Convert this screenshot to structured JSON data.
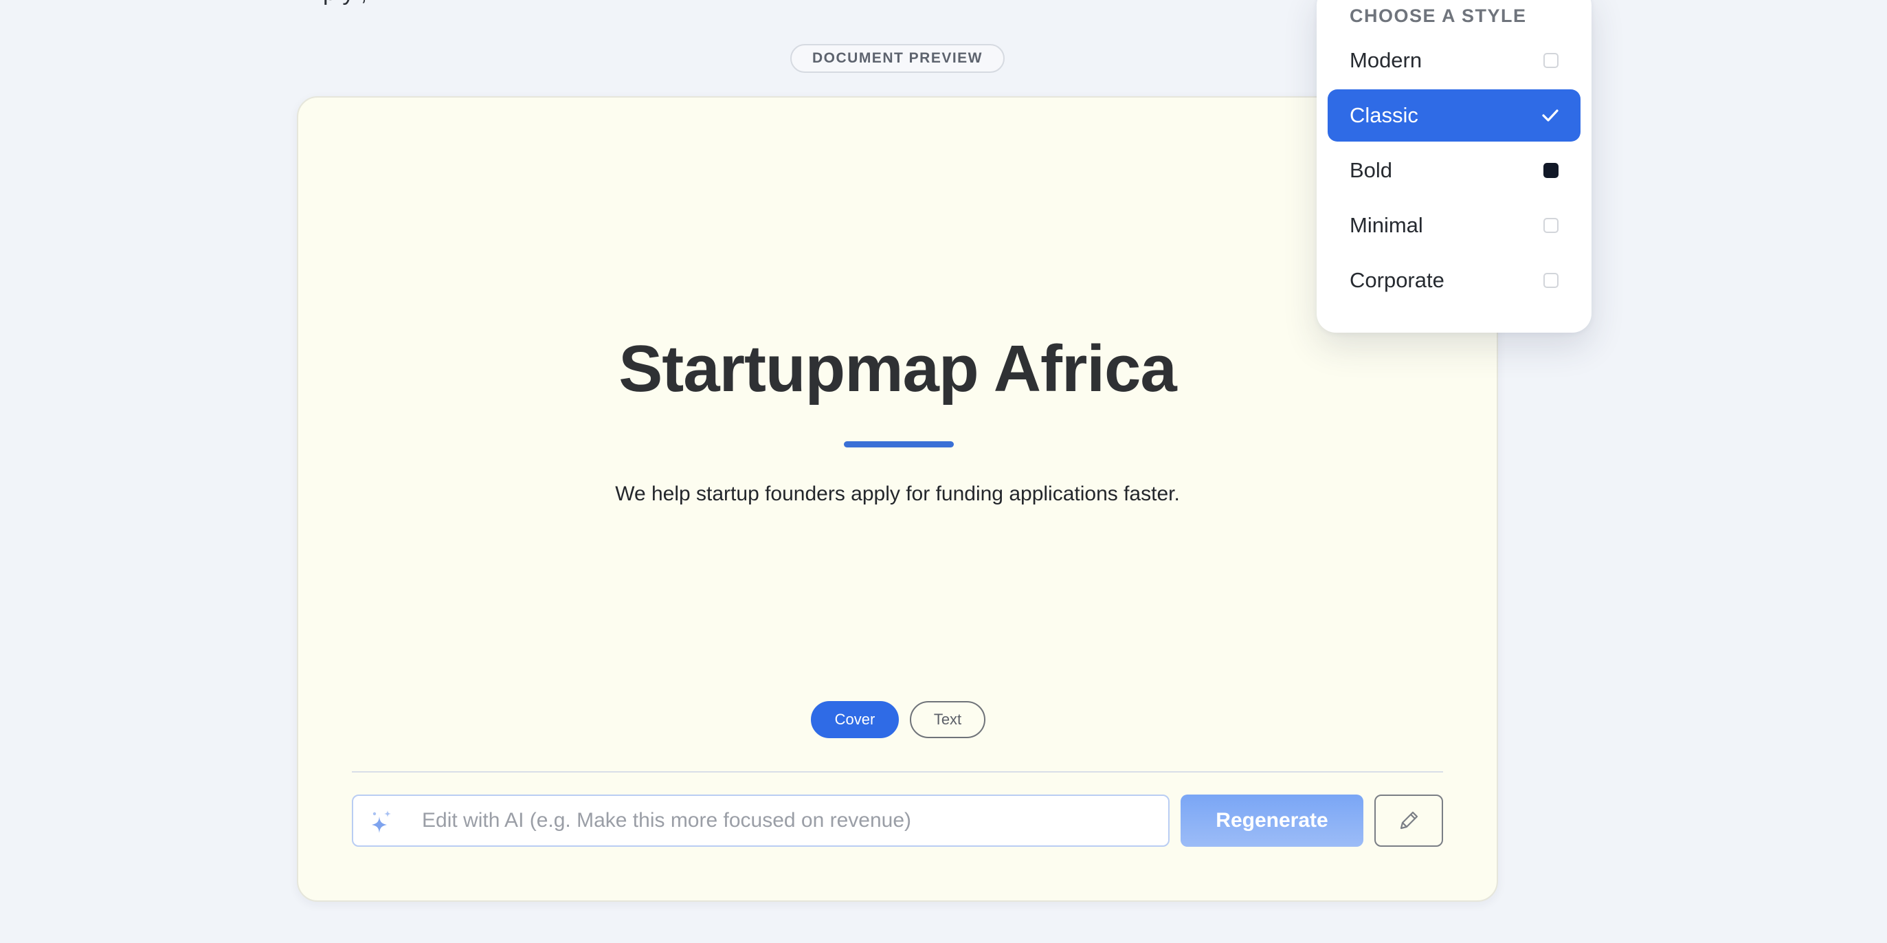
{
  "header": {
    "partial_text": "p     y                      ,"
  },
  "preview": {
    "badge_label": "DOCUMENT PREVIEW"
  },
  "document": {
    "title": "Startupmap Africa",
    "subtitle": "We help startup founders apply for funding applications faster.",
    "accent_color": "#3a70d6",
    "background_color": "#fdfdf0"
  },
  "modes": {
    "items": [
      {
        "label": "Cover",
        "active": true
      },
      {
        "label": "Text",
        "active": false
      }
    ]
  },
  "ai_edit": {
    "placeholder": "Edit with AI (e.g. Make this more focused on revenue)",
    "value": "",
    "icon": "sparkle-icon",
    "regenerate_label": "Regenerate",
    "edit_icon": "pencil-icon"
  },
  "style_menu": {
    "heading": "CHOOSE A STYLE",
    "selected": "Classic",
    "items": [
      {
        "label": "Modern",
        "state": "unchecked"
      },
      {
        "label": "Classic",
        "state": "selected"
      },
      {
        "label": "Bold",
        "state": "filled"
      },
      {
        "label": "Minimal",
        "state": "unchecked"
      },
      {
        "label": "Corporate",
        "state": "unchecked"
      }
    ],
    "selected_color": "#2f6be6"
  }
}
